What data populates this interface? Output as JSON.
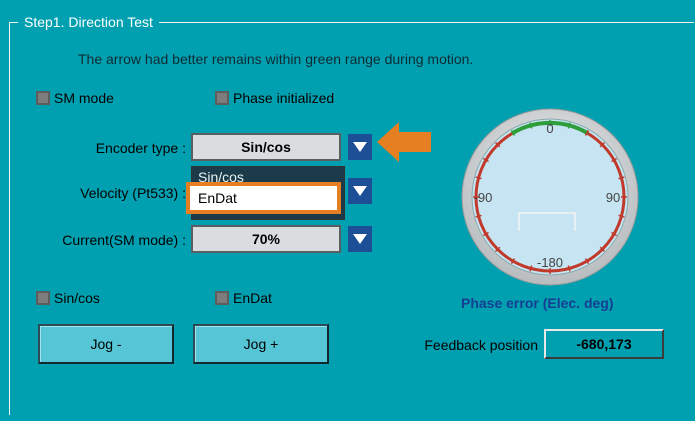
{
  "group": {
    "title": "Step1. Direction Test"
  },
  "instruction": "The arrow had better remains within green range during motion.",
  "status": {
    "sm_mode": "SM mode",
    "phase_initialized": "Phase initialized",
    "sincos": "Sin/cos",
    "endat": "EnDat"
  },
  "settings": {
    "encoder_label": "Encoder type :",
    "encoder_value": "Sin/cos",
    "encoder_options": [
      "Sin/cos",
      "EnDat"
    ],
    "velocity_label": "Velocity (Pt533) :",
    "current_label": "Current(SM mode) :",
    "current_value": "70%"
  },
  "buttons": {
    "jog_minus": "Jog -",
    "jog_plus": "Jog +"
  },
  "gauge": {
    "title": "Phase error (Elec. deg)",
    "ticks": {
      "top": "0",
      "left": "-90",
      "right": "90",
      "bottom": "-180"
    }
  },
  "feedback": {
    "label": "Feedback position",
    "value": "-680,173"
  },
  "colors": {
    "background": "#00a0b0",
    "highlight": "#e67e22",
    "gauge_green": "#2e9e3a",
    "gauge_red": "#c0392b",
    "dropdown_button": "#1d4f97"
  }
}
